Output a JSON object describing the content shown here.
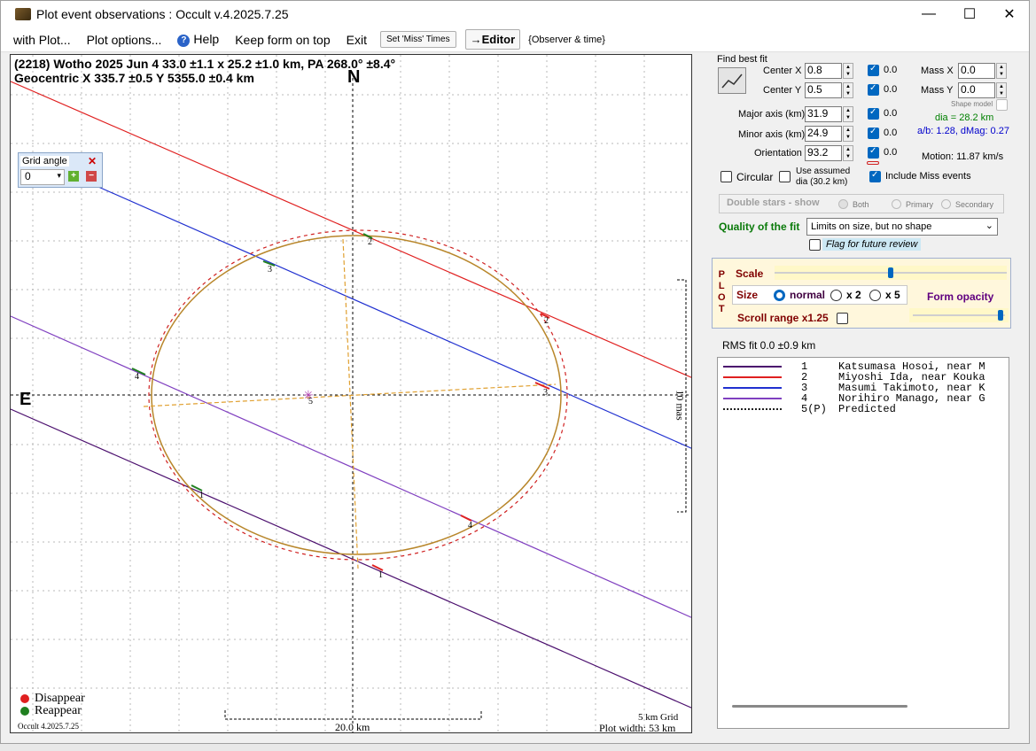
{
  "window": {
    "title": "Plot event observations : Occult v.4.2025.7.25",
    "minimize": "—",
    "maximize": "☐",
    "close": "✕"
  },
  "menu": {
    "with_plot": "with Plot...",
    "plot_options": "Plot options...",
    "help": "Help",
    "keep_on_top": "Keep form on top",
    "exit": "Exit",
    "set_miss_times": "Set 'Miss' Times",
    "editor": "→Editor",
    "observer_time": "{Observer & time}"
  },
  "plot": {
    "title": "(2218) Wotho  2025 Jun 4   33.0 ±1.1 x 25.2 ±1.0 km, PA 268.0° ±8.4°",
    "subtitle": "Geocentric  X  335.7 ±0.5  Y 5355.0 ±0.4 km",
    "north_label": "N",
    "east_label": "E",
    "scale_bar_vertical": "10 mas",
    "scale_bar_horizontal": "20.0 km",
    "grid_note": "5 km Grid",
    "plot_width": "Plot width: 53 km",
    "version": "Occult 4.2025.7.25",
    "legend_disappear": "Disappear",
    "legend_reappear": "Reappear",
    "disappear_color": "#e02020",
    "reappear_color": "#208020",
    "chord_labels": [
      "1",
      "2",
      "3",
      "4",
      "5"
    ],
    "grid_angle": {
      "label": "Grid angle",
      "value": "0",
      "close": "✕",
      "plus": "+",
      "minus": "−"
    }
  },
  "fit": {
    "find_best_fit": "Find best fit",
    "center_x_label": "Center X",
    "center_x": "0.8",
    "center_x_delta": "0.0",
    "center_y_label": "Center Y",
    "center_y": "0.5",
    "center_y_delta": "0.0",
    "mass_x_label": "Mass X",
    "mass_x": "0.0",
    "mass_y_label": "Mass Y",
    "mass_y": "0.0",
    "shape_model": "Shape model",
    "major_label": "Major axis (km)",
    "major": "31.9",
    "major_delta": "0.0",
    "minor_label": "Minor axis (km)",
    "minor": "24.9",
    "minor_delta": "0.0",
    "orientation_label": "Orientation",
    "orientation": "93.2",
    "orientation_delta": "0.0",
    "dia": "dia = 28.2 km",
    "ab": "a/b: 1.28, dMag: 0.27",
    "motion": "Motion: 11.87 km/s",
    "circular": "Circular",
    "use_assumed": "Use assumed",
    "use_assumed_dia": "dia (30.2 km)",
    "include_miss": "Include Miss events",
    "double_stars": "Double stars - show",
    "both": "Both",
    "primary": "Primary",
    "secondary": "Secondary",
    "quality_label": "Quality of the fit",
    "quality_value": "Limits on size, but no shape",
    "flag_review": "Flag for future review",
    "rms": "RMS fit 0.0 ±0.9 km"
  },
  "plotbox": {
    "side_label": [
      "P",
      "L",
      "O",
      "T"
    ],
    "scale": "Scale",
    "size": "Size",
    "normal": "normal",
    "x2": "x 2",
    "x5": "x 5",
    "form_opacity": "Form opacity",
    "scroll_range": "Scroll range x1.25"
  },
  "observers": [
    {
      "num": "1",
      "name": "Katsumasa Hosoi, near M",
      "color": "#4b0f6e",
      "style": "solid"
    },
    {
      "num": "2",
      "name": "Miyoshi Ida, near Kouka",
      "color": "#e02020",
      "style": "solid"
    },
    {
      "num": "3",
      "name": "Masumi Takimoto, near K",
      "color": "#2030d0",
      "style": "solid"
    },
    {
      "num": "4",
      "name": "Norihiro Manago, near G",
      "color": "#8040c0",
      "style": "solid"
    },
    {
      "num": "5(P)",
      "name": "Predicted",
      "color": "#222222",
      "style": "dotted"
    }
  ]
}
